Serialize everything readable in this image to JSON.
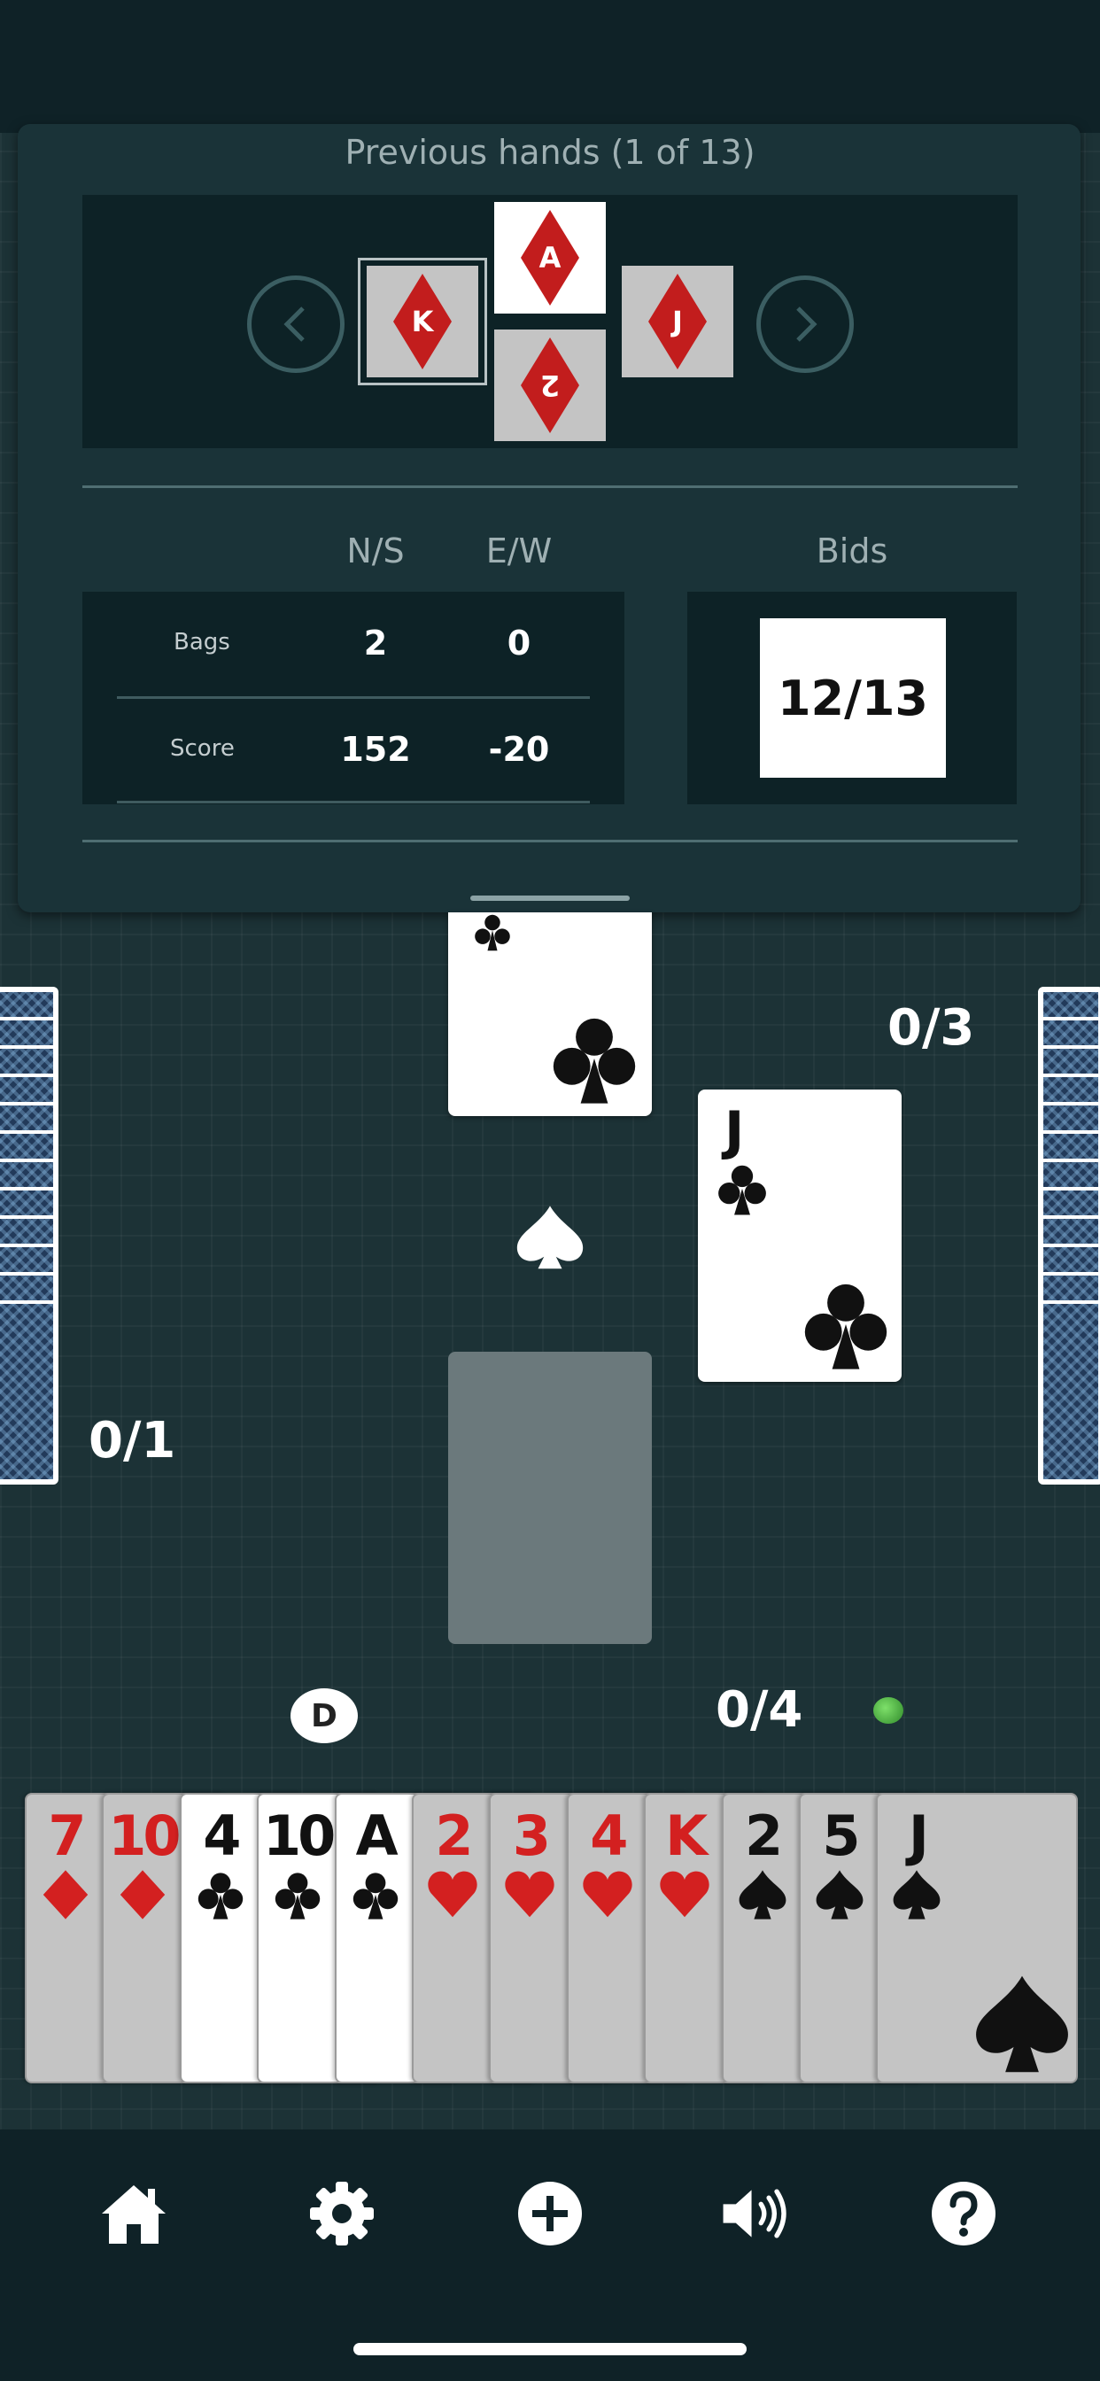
{
  "panel": {
    "title": "Previous hands (1 of 13)",
    "trick": {
      "north": {
        "rank": "A",
        "suit": "diamond"
      },
      "west": {
        "rank": "K",
        "suit": "diamond"
      },
      "east": {
        "rank": "J",
        "suit": "diamond"
      },
      "south": {
        "rank": "2",
        "suit": "diamond"
      }
    },
    "score_table": {
      "columns": [
        "N/S",
        "E/W"
      ],
      "rows": [
        {
          "label": "Bags",
          "ns": "2",
          "ew": "0"
        },
        {
          "label": "Score",
          "ns": "152",
          "ew": "-20"
        }
      ]
    },
    "bids": {
      "label": "Bids",
      "value": "12/13"
    }
  },
  "table": {
    "north_card": {
      "rank": "",
      "suit": "club"
    },
    "east_card": {
      "rank": "J",
      "suit": "club"
    },
    "trump_suit": "spade",
    "tricks": {
      "east": "0/3",
      "west": "0/1",
      "south": "0/4"
    },
    "dealer_badge": "D"
  },
  "hand": [
    {
      "rank": "7",
      "suit": "diamond",
      "color": "#d32020",
      "playable": false
    },
    {
      "rank": "10",
      "suit": "diamond",
      "color": "#d32020",
      "playable": false
    },
    {
      "rank": "4",
      "suit": "club",
      "color": "#111111",
      "playable": true
    },
    {
      "rank": "10",
      "suit": "club",
      "color": "#111111",
      "playable": true
    },
    {
      "rank": "A",
      "suit": "club",
      "color": "#111111",
      "playable": true
    },
    {
      "rank": "2",
      "suit": "heart",
      "color": "#d32020",
      "playable": false
    },
    {
      "rank": "3",
      "suit": "heart",
      "color": "#d32020",
      "playable": false
    },
    {
      "rank": "4",
      "suit": "heart",
      "color": "#d32020",
      "playable": false
    },
    {
      "rank": "K",
      "suit": "heart",
      "color": "#d32020",
      "playable": false
    },
    {
      "rank": "2",
      "suit": "spade",
      "color": "#111111",
      "playable": false
    },
    {
      "rank": "5",
      "suit": "spade",
      "color": "#111111",
      "playable": false
    },
    {
      "rank": "J",
      "suit": "spade",
      "color": "#111111",
      "playable": false
    }
  ],
  "toolbar": {
    "icons": [
      "home-icon",
      "gear-icon",
      "plus-circle-icon",
      "speaker-icon",
      "question-circle-icon"
    ]
  },
  "colors": {
    "background": "#1c3236",
    "panel": "#1a3338",
    "panel_box": "#0d2226",
    "red_suit": "#d32020",
    "turn_indicator": "#4cbf3c"
  }
}
